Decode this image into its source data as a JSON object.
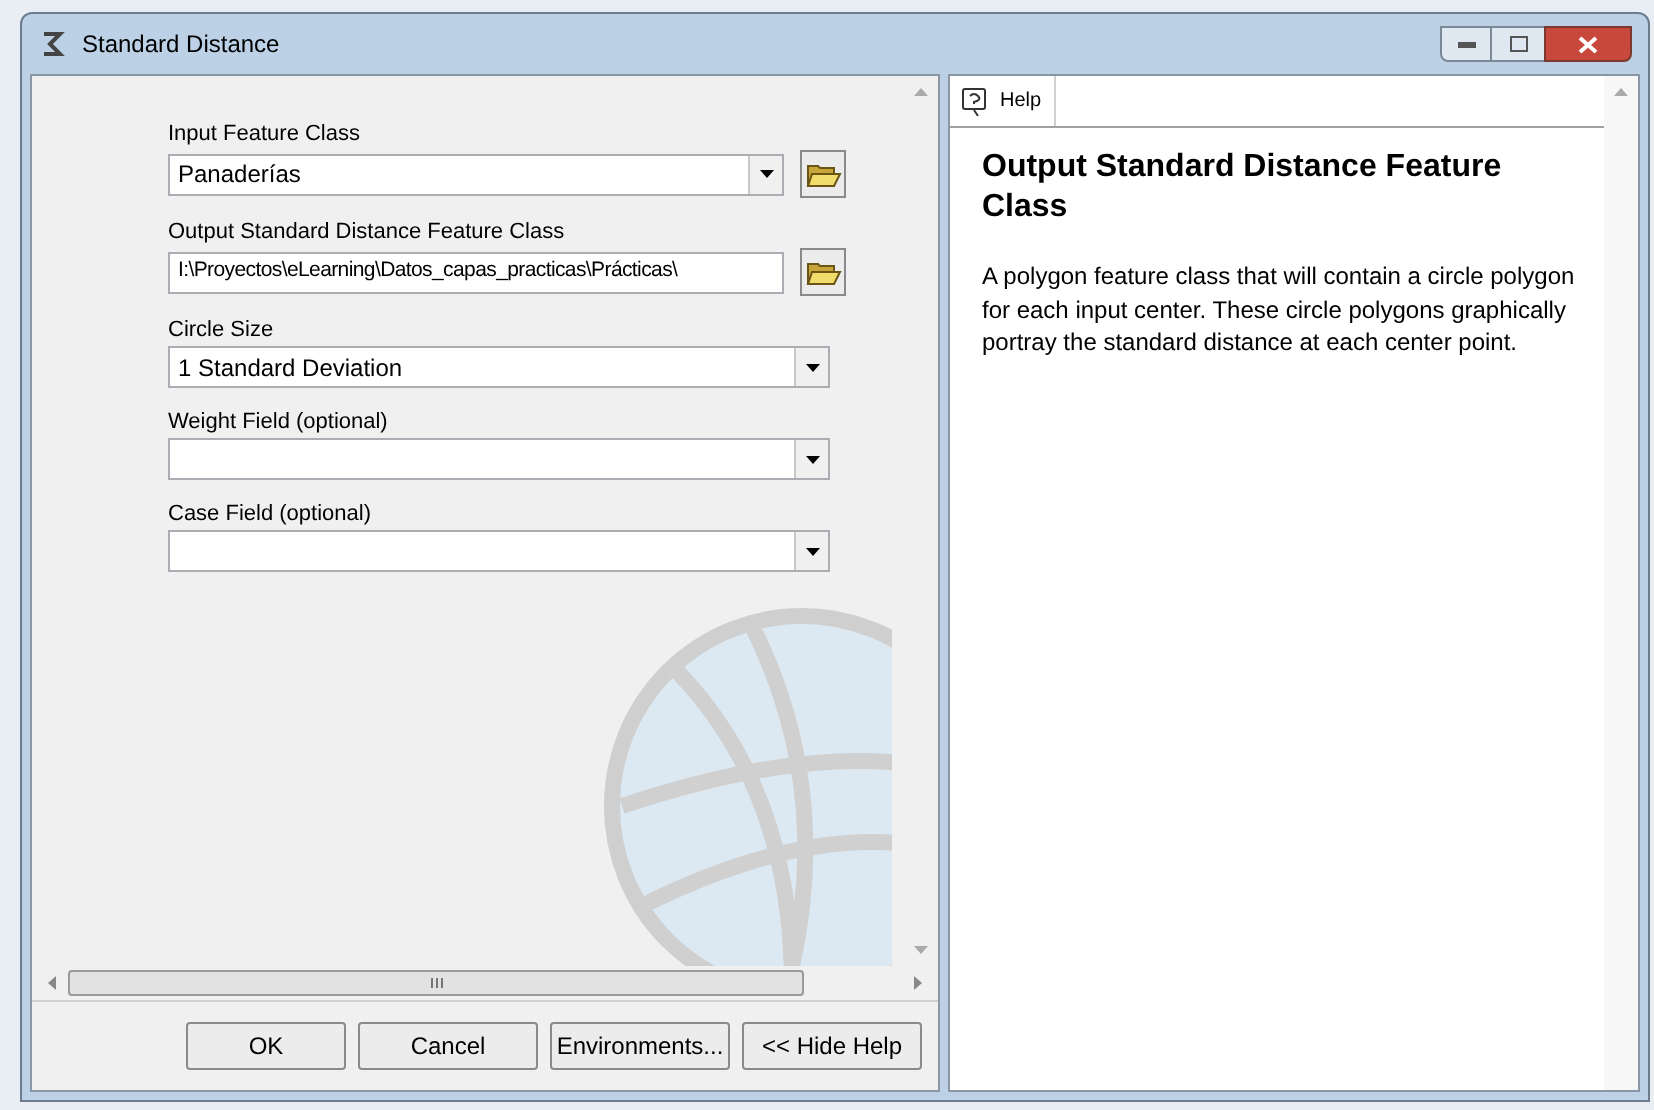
{
  "window": {
    "title": "Standard Distance"
  },
  "fields": [
    {
      "label": "Input Feature Class",
      "kind": "combo",
      "value": "Panaderías",
      "browse": true
    },
    {
      "label": "Output Standard Distance Feature Class",
      "kind": "text",
      "value": "I:\\Proyectos\\eLearning\\Datos_capas_practicas\\Prácticas\\",
      "browse": true
    },
    {
      "label": "Circle Size",
      "kind": "combo",
      "value": "1 Standard Deviation",
      "browse": false
    },
    {
      "label": "Weight Field (optional)",
      "kind": "combo",
      "browse": false
    },
    {
      "label": "Case Field (optional)",
      "kind": "combo",
      "browse": false
    }
  ],
  "buttons": [
    "OK",
    "Cancel",
    "Environments...",
    "<< Hide Help"
  ],
  "help": {
    "tab": "Help",
    "title": "Output Standard Distance Feature Class",
    "body": "A polygon feature class that will contain a circle polygon for each input center. These circle polygons graphically portray the standard distance at each center point."
  }
}
